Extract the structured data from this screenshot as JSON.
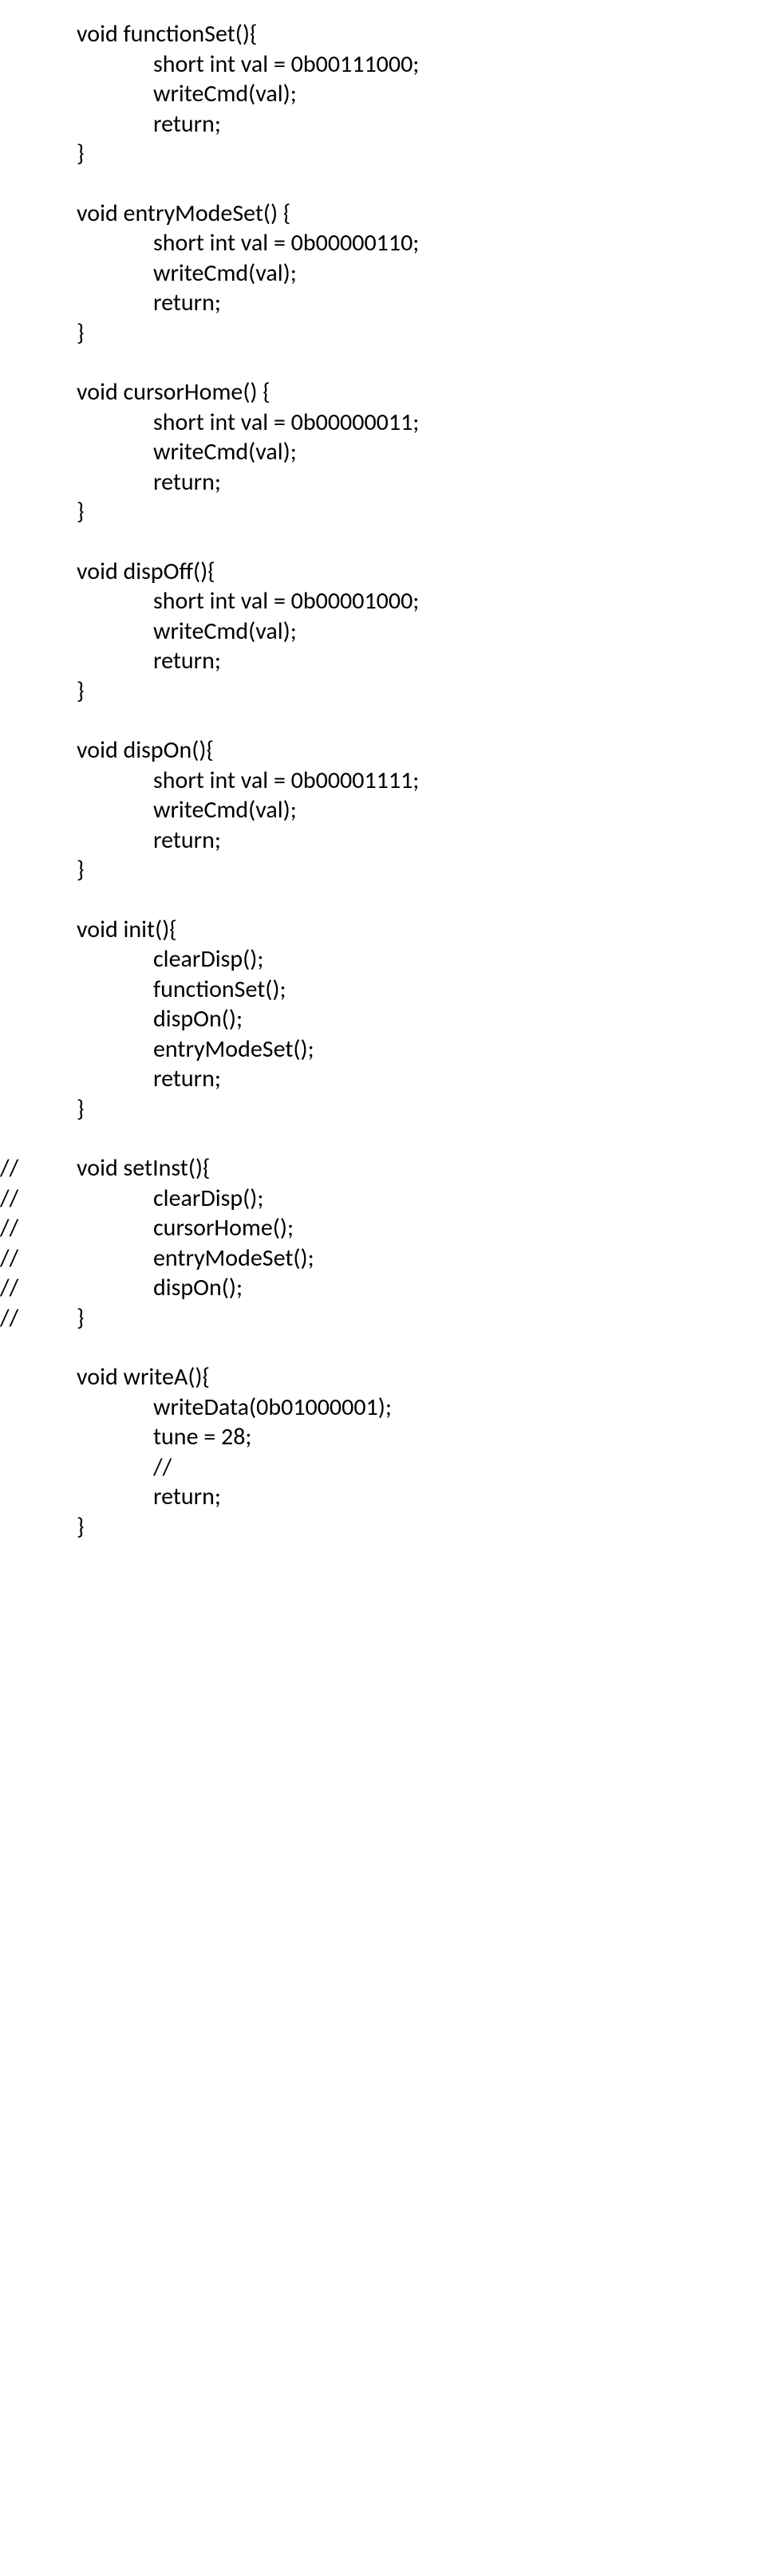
{
  "lines": [
    {
      "indent": "i0",
      "text": "void functionSet(){"
    },
    {
      "indent": "i1",
      "text": "short int val = 0b00111000;"
    },
    {
      "indent": "i1",
      "text": "writeCmd(val);"
    },
    {
      "indent": "i1",
      "text": "return;"
    },
    {
      "indent": "i0",
      "text": "}"
    },
    {
      "blank": true
    },
    {
      "indent": "i0",
      "text": "void entryModeSet() {"
    },
    {
      "indent": "i1",
      "text": "short int val = 0b00000110;"
    },
    {
      "indent": "i1",
      "text": "writeCmd(val);"
    },
    {
      "indent": "i1",
      "text": "return;"
    },
    {
      "indent": "i0",
      "text": "}"
    },
    {
      "blank": true
    },
    {
      "indent": "i0",
      "text": "void cursorHome() {"
    },
    {
      "indent": "i1",
      "text": "short int val = 0b00000011;"
    },
    {
      "indent": "i1",
      "text": "writeCmd(val);"
    },
    {
      "indent": "i1",
      "text": "return;"
    },
    {
      "indent": "i0",
      "text": "}"
    },
    {
      "blank": true
    },
    {
      "indent": "i0",
      "text": "void dispOff(){"
    },
    {
      "indent": "i1",
      "text": "short int val = 0b00001000;"
    },
    {
      "indent": "i1",
      "text": "writeCmd(val);"
    },
    {
      "indent": "i1",
      "text": "return;"
    },
    {
      "indent": "i0",
      "text": "}"
    },
    {
      "blank": true
    },
    {
      "indent": "i0",
      "text": "void dispOn(){"
    },
    {
      "indent": "i1",
      "text": "short int val = 0b00001111;"
    },
    {
      "indent": "i1",
      "text": "writeCmd(val);"
    },
    {
      "indent": "i1",
      "text": "return;"
    },
    {
      "indent": "i0",
      "text": "}"
    },
    {
      "blank": true
    },
    {
      "indent": "i0",
      "text": "void init(){"
    },
    {
      "indent": "i1",
      "text": "clearDisp();"
    },
    {
      "indent": "i1",
      "text": "functionSet();"
    },
    {
      "indent": "i1",
      "text": "dispOn();"
    },
    {
      "indent": "i1",
      "text": "entryModeSet();"
    },
    {
      "indent": "i1",
      "text": "return;"
    },
    {
      "indent": "i0",
      "text": "}"
    },
    {
      "blank": true
    },
    {
      "comment": true,
      "indent": "c1",
      "text": "void setInst(){"
    },
    {
      "comment": true,
      "indent": "c2",
      "text": "clearDisp();"
    },
    {
      "comment": true,
      "indent": "c2",
      "text": "cursorHome();"
    },
    {
      "comment": true,
      "indent": "c2",
      "text": "entryModeSet();"
    },
    {
      "comment": true,
      "indent": "c2",
      "text": "dispOn();"
    },
    {
      "comment": true,
      "indent": "c1",
      "text": "}"
    },
    {
      "blank": true
    },
    {
      "indent": "i0",
      "text": "void writeA(){"
    },
    {
      "indent": "i1",
      "text": "writeData(0b01000001);"
    },
    {
      "indent": "i1",
      "text": "tune = 28;"
    },
    {
      "indent": "i1",
      "text": "//"
    },
    {
      "indent": "i1",
      "text": "return;"
    },
    {
      "indent": "i0",
      "text": "}"
    }
  ],
  "commentMark": "//"
}
